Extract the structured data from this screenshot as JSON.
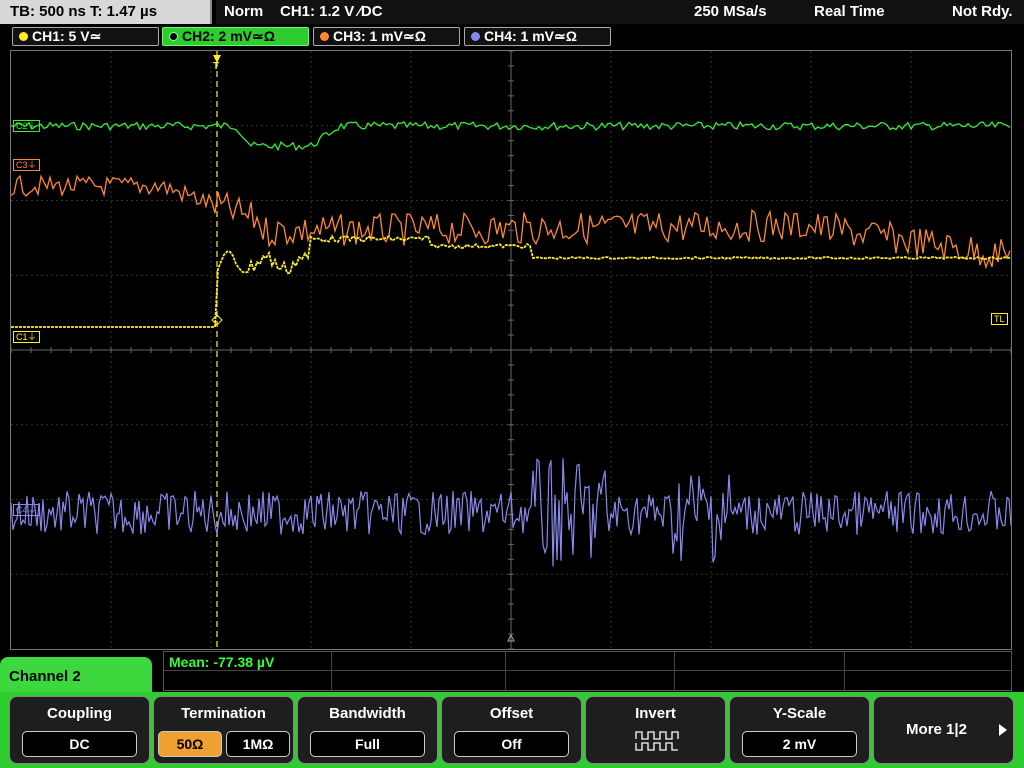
{
  "timebase": "TB: 500 ns   T: 1.47 µs",
  "status": {
    "mode": "Norm",
    "trigger": "CH1: 1.2 V ∕DC",
    "sample_rate": "250 MSa/s",
    "acq": "Real Time",
    "state": "Not Rdy."
  },
  "channels": [
    {
      "label": "CH1: 5 V≃",
      "color": "#ffee22"
    },
    {
      "label": "CH2: 2 mV≃Ω",
      "color": "#33ee33"
    },
    {
      "label": "CH3: 1 mV≃Ω",
      "color": "#ff8833"
    },
    {
      "label": "CH4: 1 mV≃Ω",
      "color": "#8888ee"
    }
  ],
  "markers": {
    "c2": "C2⏚",
    "c3": "C3⏚",
    "c1": "C1⏚",
    "c4": "C4⏚",
    "tl": "TL",
    "trig": "T"
  },
  "measurement": "Mean: -77.38 µV",
  "menu_title": "Channel 2",
  "softkeys": {
    "coupling": {
      "label": "Coupling",
      "value": "DC"
    },
    "termination": {
      "label": "Termination",
      "opt1": "50Ω",
      "opt2": "1MΩ"
    },
    "bandwidth": {
      "label": "Bandwidth",
      "value": "Full"
    },
    "offset": {
      "label": "Offset",
      "value": "Off"
    },
    "invert": {
      "label": "Invert"
    },
    "yscale": {
      "label": "Y-Scale",
      "value": "2 mV"
    },
    "more": {
      "label": "More 1|2"
    }
  }
}
